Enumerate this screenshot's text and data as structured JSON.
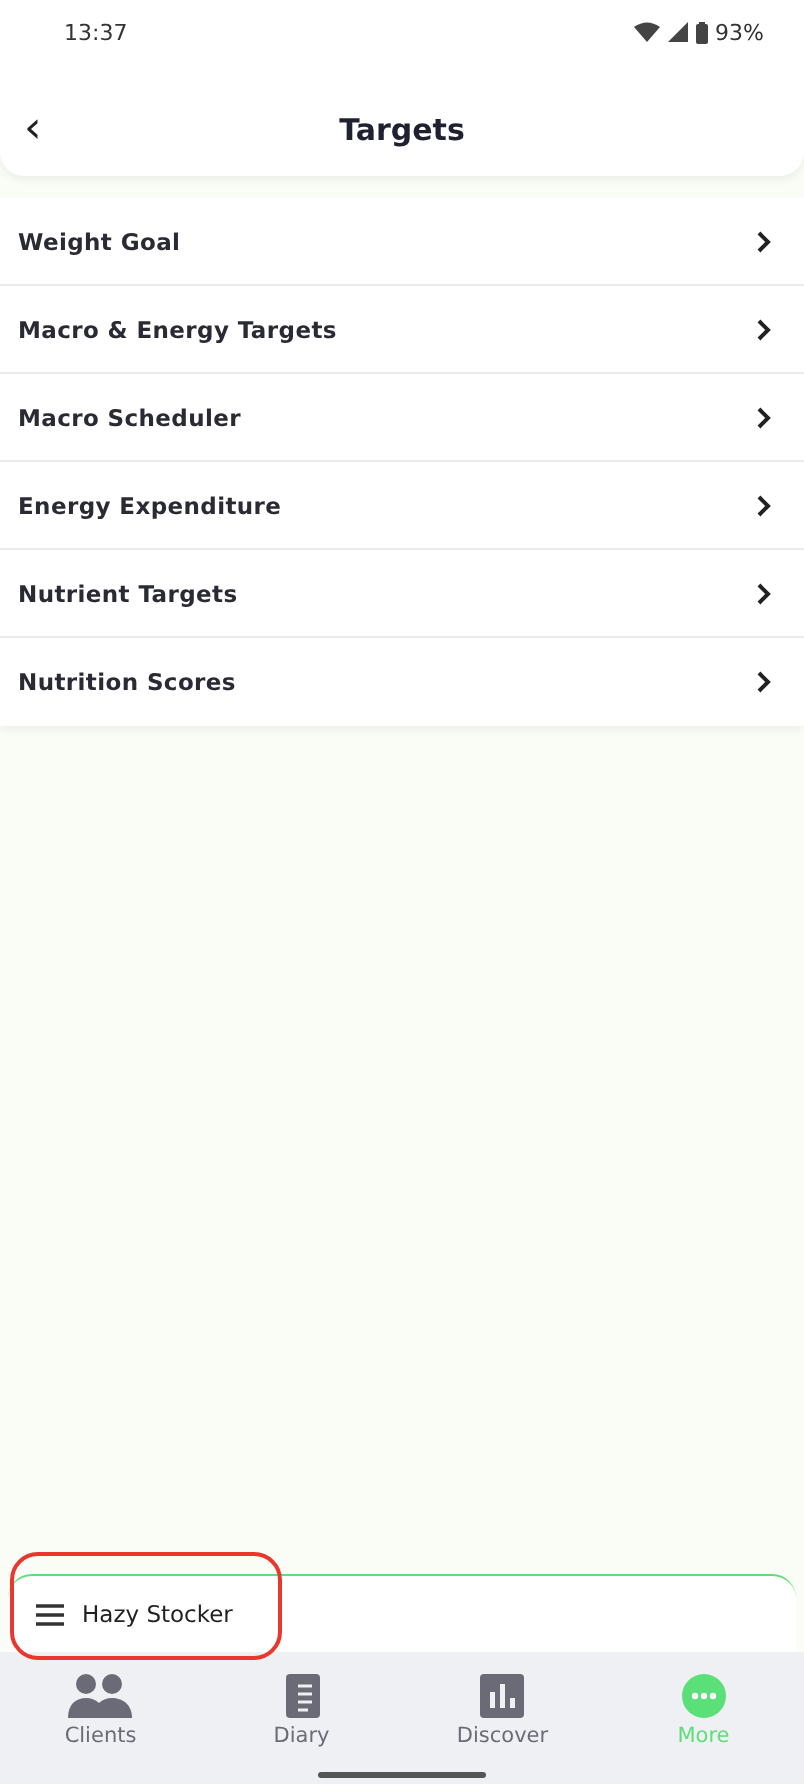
{
  "status_bar": {
    "time": "13:37",
    "battery": "93%"
  },
  "header": {
    "back": "‹",
    "title": "Targets"
  },
  "menu_items": [
    {
      "label": "Weight Goal"
    },
    {
      "label": "Macro & Energy Targets"
    },
    {
      "label": "Macro Scheduler"
    },
    {
      "label": "Energy Expenditure"
    },
    {
      "label": "Nutrient Targets"
    },
    {
      "label": "Nutrition Scores"
    }
  ],
  "client_bar": {
    "name": "Hazy Stocker",
    "highlighted": true
  },
  "nav": [
    {
      "label": "Clients",
      "kind": "clients",
      "selected": false
    },
    {
      "label": "Diary",
      "kind": "diary",
      "selected": false
    },
    {
      "label": "Discover",
      "kind": "discover",
      "selected": false
    },
    {
      "label": "More",
      "kind": "more",
      "selected": true
    }
  ]
}
